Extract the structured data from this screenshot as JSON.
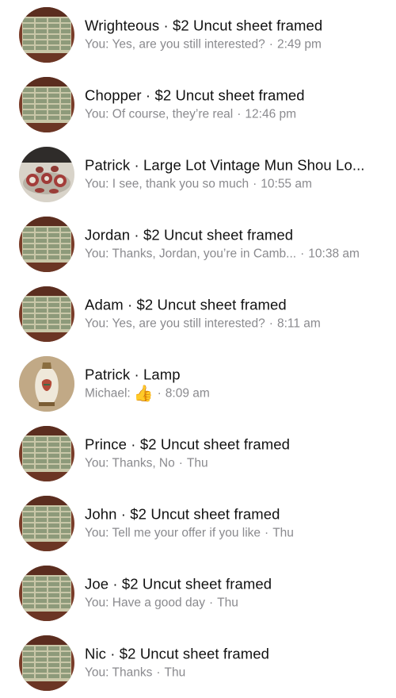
{
  "conversations": [
    {
      "avatar": "uncut-sheet-photo",
      "contact": "Wrighteous",
      "item": "$2 Uncut sheet framed",
      "preview": "You: Yes, are you still interested?",
      "time": "2:49 pm"
    },
    {
      "avatar": "uncut-sheet-photo",
      "contact": "Chopper",
      "item": "$2 Uncut sheet framed",
      "preview": "You: Of course, they’re real",
      "time": "12:46 pm"
    },
    {
      "avatar": "dish-set-photo",
      "contact": "Patrick",
      "item": "Large Lot Vintage Mun Shou Lo...",
      "preview": "You: I see, thank you so much",
      "time": "10:55 am"
    },
    {
      "avatar": "uncut-sheet-photo",
      "contact": "Jordan",
      "item": "$2 Uncut sheet framed",
      "preview": "You: Thanks, Jordan, you’re in Camb...",
      "time": "10:38 am"
    },
    {
      "avatar": "uncut-sheet-photo",
      "contact": "Adam",
      "item": "$2 Uncut sheet framed",
      "preview": "You: Yes, are you still interested?",
      "time": "8:11 am"
    },
    {
      "avatar": "lamp-photo",
      "contact": "Patrick",
      "item": "Lamp",
      "preview": "Michael:",
      "preview_icon": "thumbs-up-icon",
      "time": "8:09 am"
    },
    {
      "avatar": "uncut-sheet-photo",
      "contact": "Prince",
      "item": "$2 Uncut sheet framed",
      "preview": "You: Thanks, No",
      "time": "Thu"
    },
    {
      "avatar": "uncut-sheet-photo",
      "contact": "John",
      "item": "$2 Uncut sheet framed",
      "preview": "You: Tell me your offer if you like",
      "time": "Thu"
    },
    {
      "avatar": "uncut-sheet-photo",
      "contact": "Joe",
      "item": "$2 Uncut sheet framed",
      "preview": "You: Have a good day",
      "time": "Thu"
    },
    {
      "avatar": "uncut-sheet-photo",
      "contact": "Nic",
      "item": "$2 Uncut sheet framed",
      "preview": "You: Thanks",
      "time": "Thu"
    }
  ],
  "separator": "·",
  "colors": {
    "title": "#111111",
    "preview": "#8a8a8e",
    "sheet_green": "#9aa58a",
    "frame_dark": "#3a241c"
  }
}
